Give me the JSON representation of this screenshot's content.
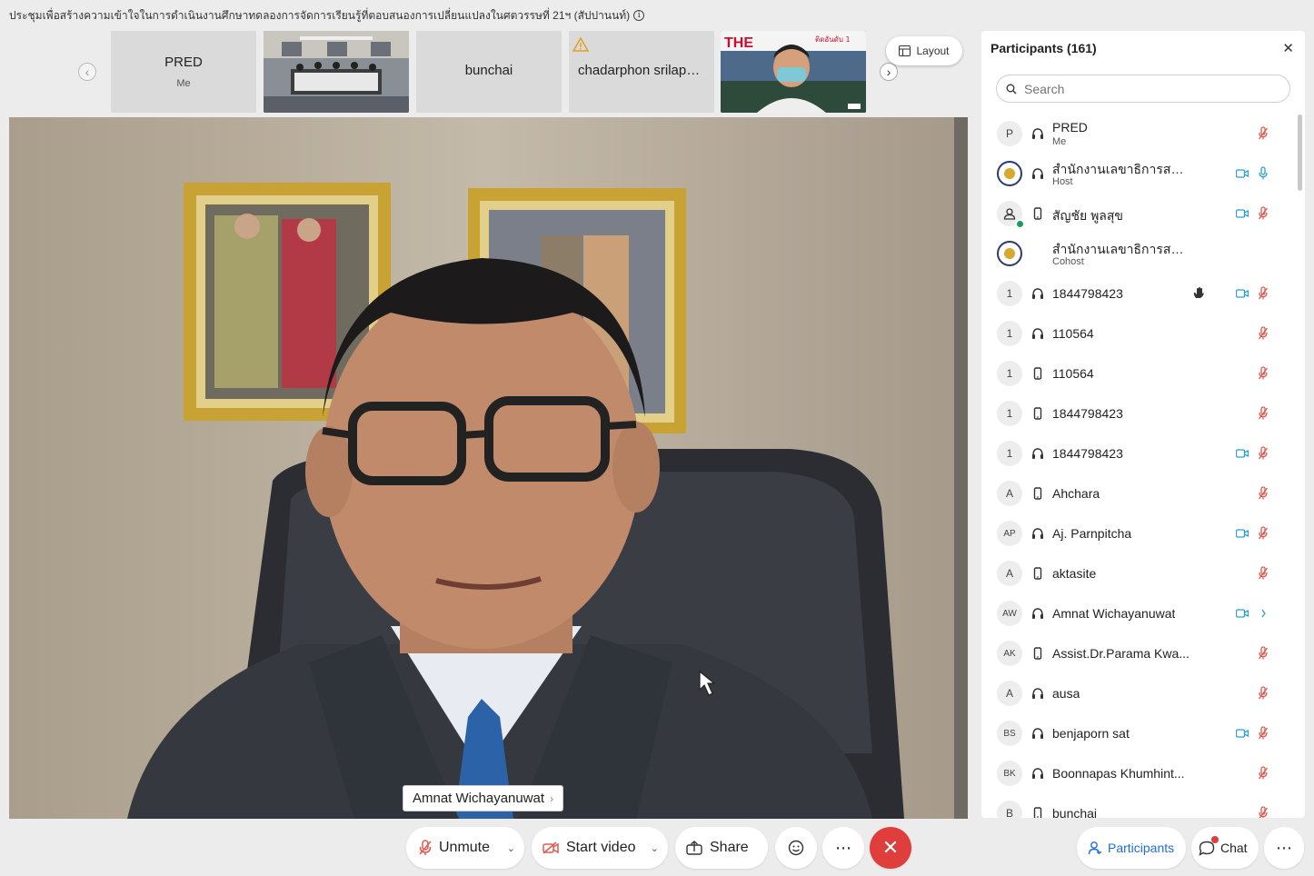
{
  "title": "ประชุมเพื่อสร้างความเข้าใจในการดำเนินงานศึกษาทดลองการจัดการเรียนรู้ที่ตอบสนองการเปลี่ยนแปลงในศตวรรษที่ 21ฯ (สัปปานนท์)",
  "info_symbol": "i",
  "strip": {
    "nav_prev": "‹",
    "nav_next": "›",
    "tiles": [
      {
        "name": "PRED",
        "sub": "Me"
      },
      {
        "name": ""
      },
      {
        "name": "bunchai"
      },
      {
        "name": "chadarphon srilap…",
        "warning": true
      },
      {
        "banner_text": "THE",
        "banner_sub": "ติดอันดับ 1"
      }
    ],
    "layout_label": "Layout"
  },
  "main_video": {
    "speaker_name": "Amnat Wichayanuwat",
    "chevron": "›"
  },
  "toolbar": {
    "unmute": "Unmute",
    "start_video": "Start video",
    "share": "Share",
    "more": "⋯",
    "end": "✕",
    "caret": "⌄"
  },
  "participants_panel": {
    "title": "Participants (161)",
    "close": "✕",
    "search_placeholder": "Search",
    "items": [
      {
        "avatar": "P",
        "name": "PRED",
        "role": "Me",
        "audio": "headset",
        "video": false,
        "mic": "muted",
        "hand": false
      },
      {
        "avatar": "",
        "emblem": true,
        "name": "สำนักงานเลขาธิการสภา...",
        "role": "Host",
        "audio": "headset",
        "video": true,
        "mic": "on",
        "hand": false
      },
      {
        "avatar": "",
        "person": true,
        "name": "สัญชัย พูลสุข",
        "role": "",
        "audio": "phone",
        "video": true,
        "mic": "muted",
        "hand": false
      },
      {
        "avatar": "",
        "emblem": true,
        "name": "สำนักงานเลขาธิการสภา...",
        "role": "Cohost",
        "audio": "none",
        "video": false,
        "mic": "none",
        "hand": false
      },
      {
        "avatar": "1",
        "name": "1844798423",
        "role": "",
        "audio": "headset",
        "video": true,
        "mic": "muted",
        "hand": true
      },
      {
        "avatar": "1",
        "name": "110564",
        "role": "",
        "audio": "headset",
        "video": false,
        "mic": "muted",
        "hand": false
      },
      {
        "avatar": "1",
        "name": "110564",
        "role": "",
        "audio": "phone",
        "video": false,
        "mic": "muted",
        "hand": false
      },
      {
        "avatar": "1",
        "name": "1844798423",
        "role": "",
        "audio": "phone",
        "video": false,
        "mic": "muted",
        "hand": false
      },
      {
        "avatar": "1",
        "name": "1844798423",
        "role": "",
        "audio": "headset",
        "video": true,
        "mic": "muted",
        "hand": false
      },
      {
        "avatar": "A",
        "name": "Ahchara",
        "role": "",
        "audio": "phone",
        "video": false,
        "mic": "muted",
        "hand": false
      },
      {
        "avatar": "AP",
        "name": "Aj. Parnpitcha",
        "role": "",
        "audio": "headset",
        "video": true,
        "mic": "muted",
        "hand": false
      },
      {
        "avatar": "A",
        "name": "aktasite",
        "role": "",
        "audio": "phone",
        "video": false,
        "mic": "muted",
        "hand": false
      },
      {
        "avatar": "AW",
        "name": "Amnat Wichayanuwat",
        "role": "",
        "audio": "headset",
        "video": true,
        "mic": "speaking",
        "hand": false
      },
      {
        "avatar": "AK",
        "name": "Assist.Dr.Parama Kwa...",
        "role": "",
        "audio": "phone",
        "video": false,
        "mic": "muted",
        "hand": false
      },
      {
        "avatar": "A",
        "name": "ausa",
        "role": "",
        "audio": "headset",
        "video": false,
        "mic": "muted",
        "hand": false
      },
      {
        "avatar": "BS",
        "name": "benjaporn sat",
        "role": "",
        "audio": "headset",
        "video": true,
        "mic": "muted",
        "hand": false
      },
      {
        "avatar": "BK",
        "name": "Boonnapas Khumhint...",
        "role": "",
        "audio": "headset",
        "video": false,
        "mic": "muted",
        "hand": false
      },
      {
        "avatar": "B",
        "name": "bunchai",
        "role": "",
        "audio": "phone",
        "video": false,
        "mic": "muted",
        "hand": false
      }
    ]
  },
  "bottom_right": {
    "participants": "Participants",
    "chat": "Chat",
    "more": "⋯"
  },
  "colors": {
    "accent_blue": "#1f6fd1",
    "end_red": "#e03d3d",
    "muted_mic": "#e0584e",
    "cam_blue": "#2a9fd6"
  }
}
